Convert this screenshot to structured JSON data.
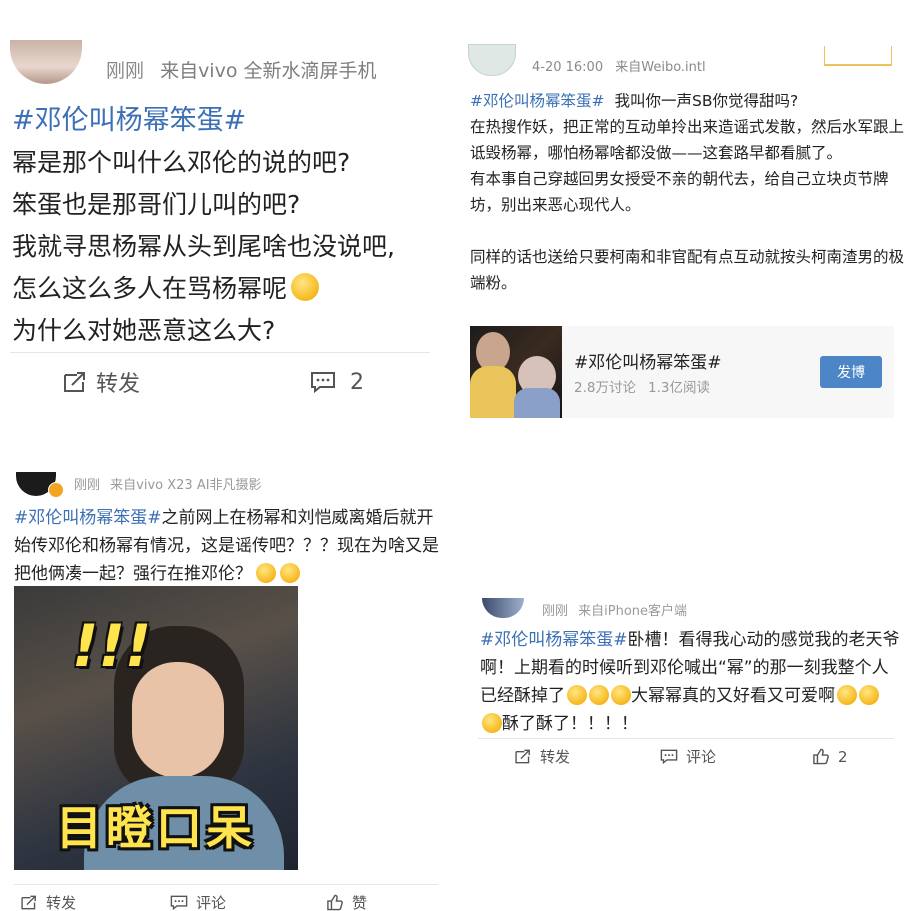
{
  "panel_a": {
    "meta_time": "刚刚",
    "meta_source": "来自vivo 全新水滴屏手机",
    "hashtag": "#邓伦叫杨幂笨蛋#",
    "lines": [
      "幂是那个叫什么邓伦的说的吧?",
      "笨蛋也是那哥们儿叫的吧?",
      "我就寻思杨幂从头到尾啥也没说吧,",
      "怎么这么多人在骂杨幂呢",
      "为什么对她恶意这么大?"
    ],
    "repost_label": "转发",
    "comment_count": "2"
  },
  "panel_b": {
    "meta_time": "4-20 16:00",
    "meta_source": "来自Weibo.intl",
    "hashtag": "#邓伦叫杨幂笨蛋#",
    "first_line": "我叫你一声SB你觉得甜吗?",
    "para1": "在热搜作妖，把正常的互动单拎出来造谣式发散，然后水军跟上诋毁杨幂，哪怕杨幂啥都没做——这套路早都看腻了。",
    "para2": "有本事自己穿越回男女授受不亲的朝代去，给自己立块贞节牌坊，别出来恶心现代人。",
    "para3": "同样的话也送给只要柯南和非官配有点互动就按头柯南渣男的极端粉。",
    "card": {
      "title": "#邓伦叫杨幂笨蛋#",
      "discussions": "2.8万讨论",
      "reads": "1.3亿阅读",
      "button": "发博"
    }
  },
  "panel_c": {
    "meta_time": "刚刚",
    "meta_source": "来自vivo X23 AI非凡摄影",
    "hashtag": "#邓伦叫杨幂笨蛋#",
    "text": "之前网上在杨幂和刘恺威离婚后就开始传邓伦和杨幂有情况，这是谣传吧？？？现在为啥又是把他俩凑一起？强行在推邓伦？",
    "meme_caption": "目瞪口呆",
    "meme_excl": "!!!",
    "repost_label": "转发",
    "comment_label": "评论",
    "like_label": "赞"
  },
  "panel_d": {
    "meta_time": "刚刚",
    "meta_source": "来自iPhone客户端",
    "hashtag": "#邓伦叫杨幂笨蛋#",
    "text1": "卧槽！看得我心动的感觉我的老天爷啊！上期看的时候听到邓伦喊出“幂”的那一刻我整个人已经酥掉了",
    "text2": "大幂幂真的又好看又可爱啊",
    "text3": "酥了酥了！！！！",
    "repost_label": "转发",
    "comment_label": "评论",
    "like_count": "2"
  },
  "colors": {
    "hashtag": "#3b6fb6",
    "button": "#4d86c6",
    "meme_text": "#ffe44d"
  }
}
